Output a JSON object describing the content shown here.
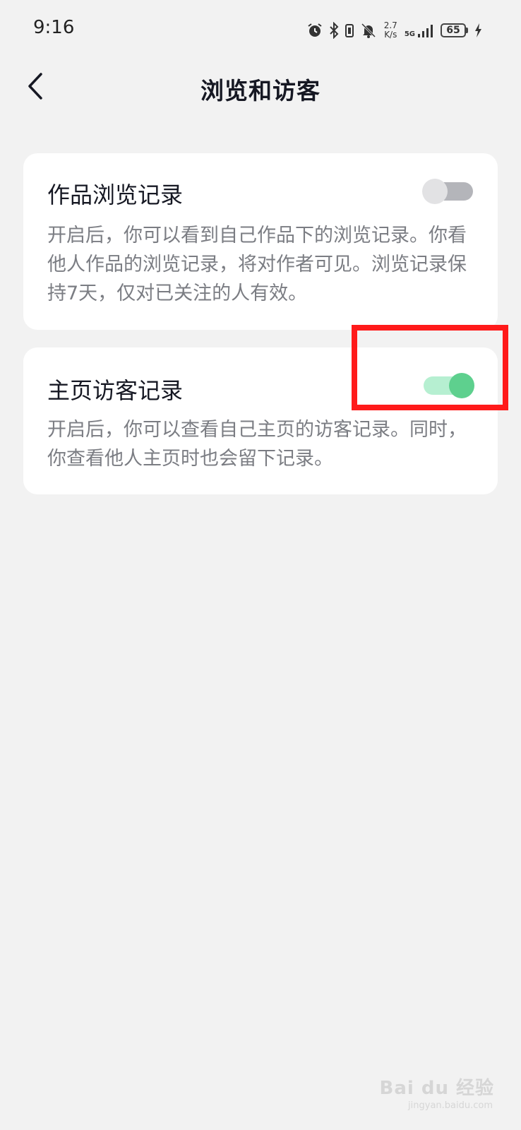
{
  "status_bar": {
    "time": "9:16",
    "speed_value": "2.7",
    "speed_unit": "K/s",
    "network": "5G",
    "battery": "65",
    "icons": [
      "alarm-icon",
      "bluetooth-icon",
      "vibrate-icon",
      "bell-off-icon",
      "signal-icon",
      "battery-icon",
      "charging-icon"
    ]
  },
  "nav": {
    "back_icon": "chevron-left-icon",
    "title": "浏览和访客"
  },
  "settings": [
    {
      "title": "作品浏览记录",
      "description": "开启后，你可以看到自己作品下的浏览记录。你看他人作品的浏览记录，将对作者可见。浏览记录保持7天，仅对已关注的人有效。",
      "enabled": false
    },
    {
      "title": "主页访客记录",
      "description": "开启后，你可以查看自己主页的访客记录。同时，你查看他人主页时也会留下记录。",
      "enabled": true
    }
  ],
  "colors": {
    "background": "#f2f2f2",
    "card": "#ffffff",
    "toggle_on": "#5ed08e",
    "toggle_off": "#b4b5ba",
    "highlight": "#ff1a1a"
  },
  "watermark": {
    "brand": "Bai du 经验",
    "url": "jingyan.baidu.com"
  }
}
